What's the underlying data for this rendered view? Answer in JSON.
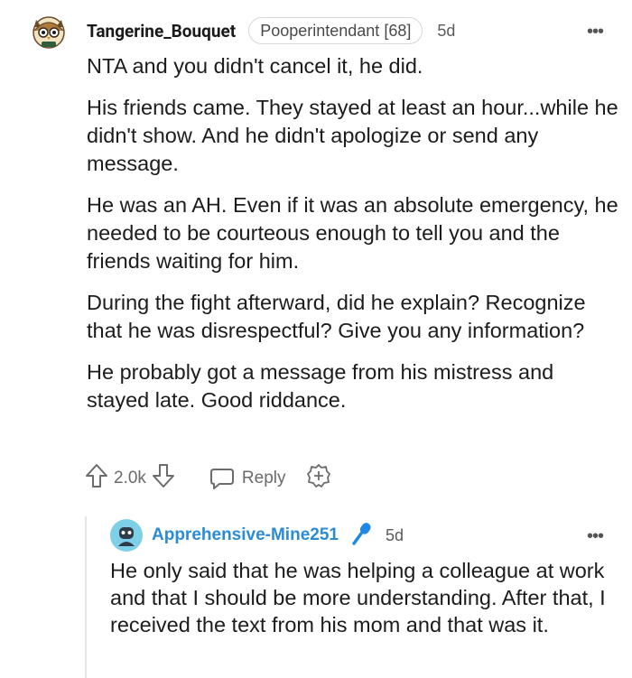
{
  "comment": {
    "username": "Tangerine_Bouquet",
    "flair": "Pooperintendant [68]",
    "age": "5d",
    "more_icon": "ellipsis-icon",
    "paragraphs": [
      "NTA and you didn't cancel it, he did.",
      "His friends came. They stayed at least an hour...while he didn't show. And he didn't apologize or send any message.",
      "He was an AH. Even if it was an absolute emergency, he needed to be courteous enough to tell you and the friends waiting for him.",
      "During the fight afterward, did he explain? Recognize that he was disrespectful? Give you any information?",
      "He probably got a message from his mistress and stayed late. Good riddance."
    ],
    "votes": "2.0k",
    "reply_label": "Reply"
  },
  "reply": {
    "username": "Apprehensive-Mine251",
    "badge_icon": "microphone-icon",
    "age": "5d",
    "text": "He only said that he was helping a colleague at work and that I should be more understanding. After that, I received the text from his mom and that was it."
  },
  "colors": {
    "text": "#1a1a1b",
    "muted": "#6b6b6b",
    "op_username": "#2a8cd6",
    "accent_mic": "#1e88e5"
  }
}
